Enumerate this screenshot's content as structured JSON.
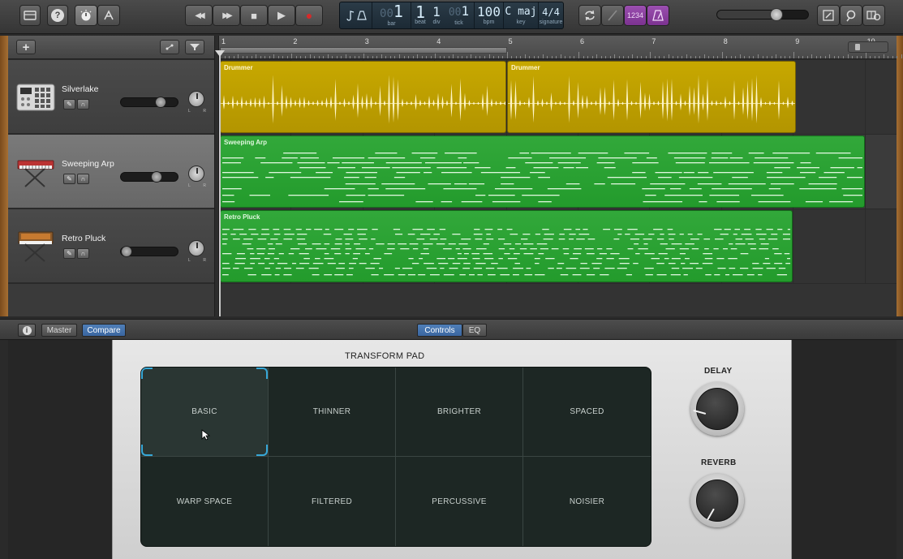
{
  "toolbar": {
    "library_icon": "library-icon",
    "help_label": "?",
    "smart_controls_icon": "smart-controls-icon",
    "editors_icon": "editors-icon",
    "rewind_label": "◀◀",
    "forward_label": "▶▶",
    "stop_label": "■",
    "play_label": "▶",
    "record_label": "●",
    "lcd": {
      "bar": "1",
      "bar_label": "bar",
      "beat": "1",
      "beat_label": "beat",
      "div": "1",
      "div_label": "div",
      "tick": "1",
      "tick_label": "tick",
      "tick_prefix": "00",
      "bar_prefix": "00",
      "bpm": "100",
      "bpm_label": "bpm",
      "key": "C maj",
      "key_label": "key",
      "signature": "4/4",
      "signature_label": "signature"
    },
    "cycle_icon": "cycle-icon",
    "tuner_icon": "tuner-icon",
    "count_in_label": "1234",
    "metronome_icon": "metronome-icon",
    "master_volume": 0.66,
    "notepad_icon": "notepad-icon",
    "loops_icon": "loops-icon",
    "media_icon": "media-icon"
  },
  "tracks_header": {
    "add_label": "+"
  },
  "ruler": {
    "bars": [
      "1",
      "2",
      "3",
      "4",
      "5",
      "6",
      "7",
      "8",
      "9",
      "10"
    ]
  },
  "tracks": [
    {
      "name": "Silverlake",
      "volume": 0.72
    },
    {
      "name": "Sweeping Arp",
      "volume": 0.63
    },
    {
      "name": "Retro Pluck",
      "volume": 0.0
    }
  ],
  "regions": {
    "drummer_1": "Drummer",
    "drummer_2": "Drummer",
    "sweeping_arp": "Sweeping Arp",
    "retro_pluck": "Retro Pluck"
  },
  "bottom_bar": {
    "info_label": "i",
    "master_label": "Master",
    "compare_label": "Compare",
    "controls_label": "Controls",
    "eq_label": "EQ"
  },
  "plugin": {
    "title": "TRANSFORM PAD",
    "pads": [
      "BASIC",
      "THINNER",
      "BRIGHTER",
      "SPACED",
      "WARP SPACE",
      "FILTERED",
      "PERCUSSIVE",
      "NOISIER"
    ],
    "selected_pad": "BASIC",
    "delay_label": "DELAY",
    "reverb_label": "REVERB"
  },
  "colors": {
    "drummer_region": "#c7a800",
    "instrument_region": "#2ea236",
    "selection": "#37a8d8",
    "count_in": "#8a3fa0"
  }
}
